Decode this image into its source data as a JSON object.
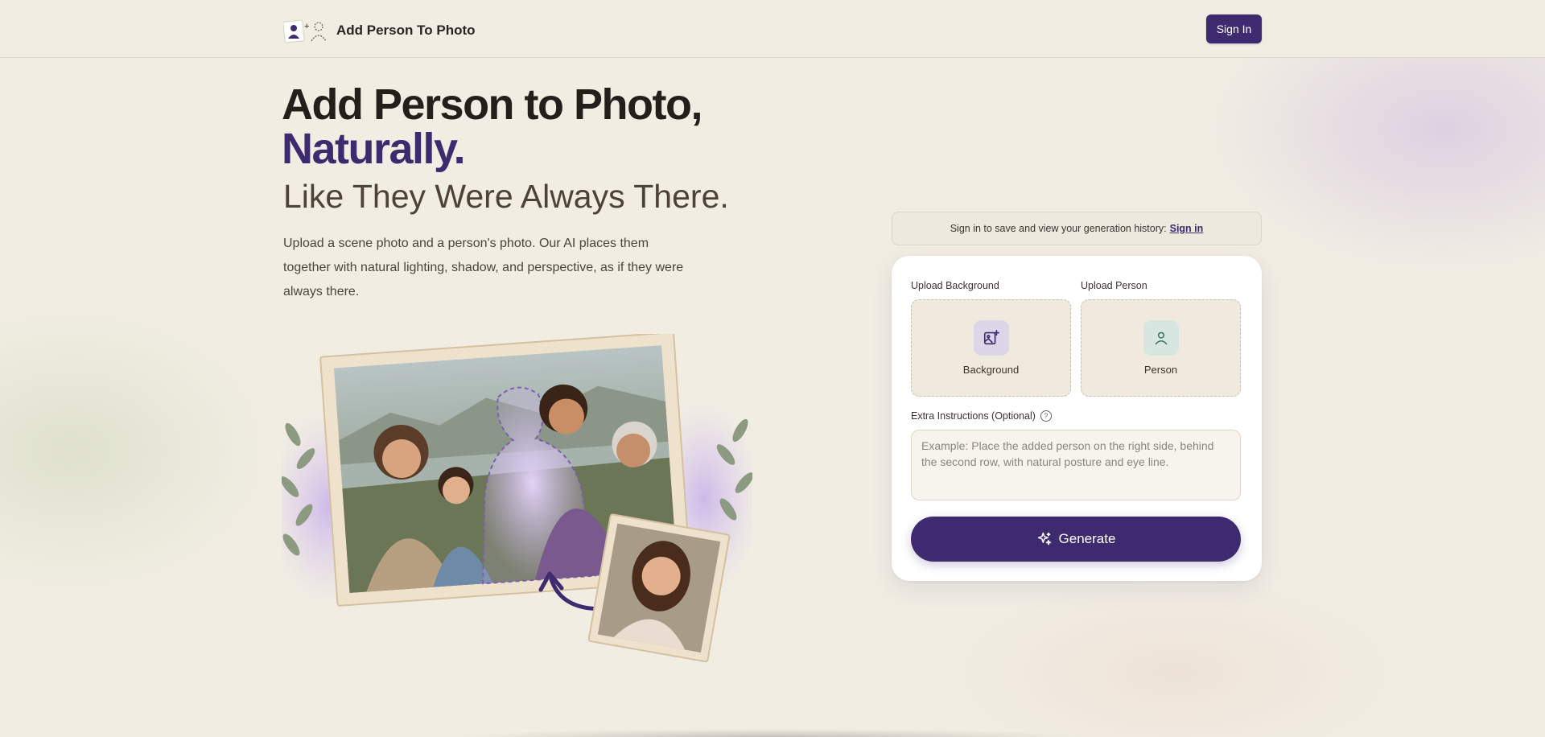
{
  "header": {
    "app_title": "Add Person To Photo",
    "signin_label": "Sign In"
  },
  "hero": {
    "title_line1": "Add Person to Photo,",
    "title_line2": "Naturally.",
    "subtitle": "Like They Were Always There.",
    "description": "Upload a scene photo and a person's photo. Our AI places them together with natural lighting, shadow, and perspective, as if they were always there."
  },
  "history": {
    "text": "Sign in to save and view your generation history:",
    "link_label": "Sign in"
  },
  "form": {
    "background_label": "Upload Background",
    "background_box_text": "Background",
    "person_label": "Upload Person",
    "person_box_text": "Person",
    "extra_label": "Extra Instructions (Optional)",
    "extra_placeholder": "Example: Place the added person on the right side, behind the second row, with natural posture and eye line.",
    "extra_value": "",
    "generate_label": "Generate"
  },
  "colors": {
    "accent": "#3e2a6e",
    "page_bg": "#f1ede3",
    "card_bg": "#ffffff"
  },
  "icons": [
    "logo-mark-icon",
    "image-plus-icon",
    "person-icon",
    "help-icon",
    "sparkles-icon"
  ]
}
